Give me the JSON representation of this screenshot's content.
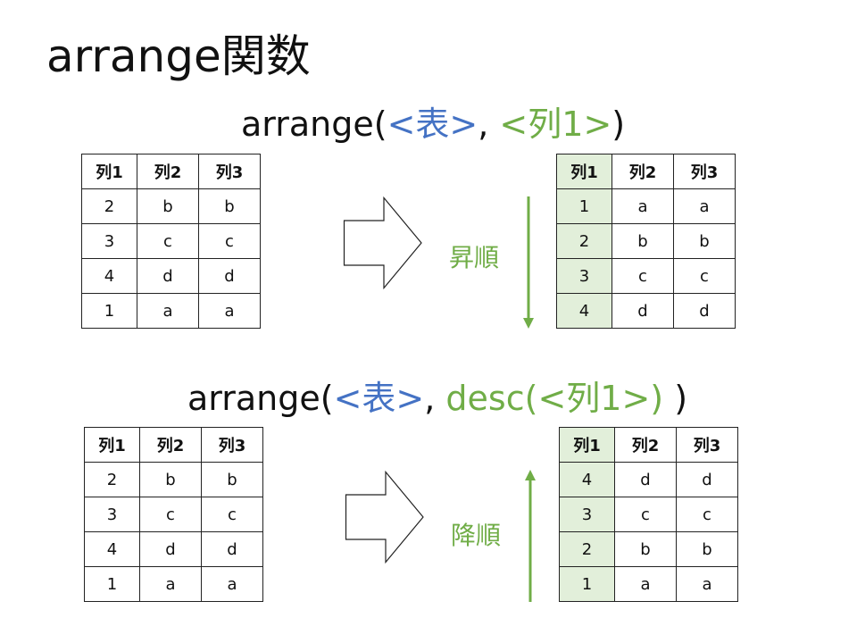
{
  "title": "arrange関数",
  "formula_asc": {
    "prefix": "arrange(",
    "table_arg": "<表>",
    "sep": ", ",
    "col_arg": "<列1>",
    "suffix": ")"
  },
  "formula_desc": {
    "prefix": "arrange(",
    "table_arg": "<表>",
    "sep": ", ",
    "col_arg": "desc(<列1>)",
    "suffix": " )"
  },
  "headers": [
    "列1",
    "列2",
    "列3"
  ],
  "asc": {
    "label": "昇順",
    "before": [
      [
        "2",
        "b",
        "b"
      ],
      [
        "3",
        "c",
        "c"
      ],
      [
        "4",
        "d",
        "d"
      ],
      [
        "1",
        "a",
        "a"
      ]
    ],
    "after": [
      [
        "1",
        "a",
        "a"
      ],
      [
        "2",
        "b",
        "b"
      ],
      [
        "3",
        "c",
        "c"
      ],
      [
        "4",
        "d",
        "d"
      ]
    ]
  },
  "desc": {
    "label": "降順",
    "before": [
      [
        "2",
        "b",
        "b"
      ],
      [
        "3",
        "c",
        "c"
      ],
      [
        "4",
        "d",
        "d"
      ],
      [
        "1",
        "a",
        "a"
      ]
    ],
    "after": [
      [
        "4",
        "d",
        "d"
      ],
      [
        "3",
        "c",
        "c"
      ],
      [
        "2",
        "b",
        "b"
      ],
      [
        "1",
        "a",
        "a"
      ]
    ]
  },
  "colors": {
    "blue": "#4472c4",
    "green": "#70ad47",
    "highlight": "#e2efda"
  }
}
